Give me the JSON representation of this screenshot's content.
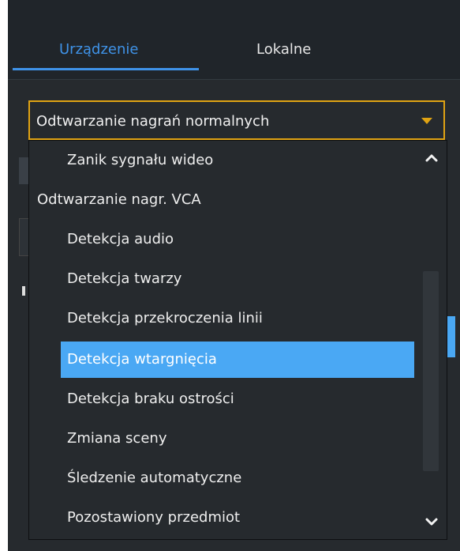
{
  "tabs": [
    {
      "label": "Urządzenie",
      "active": true
    },
    {
      "label": "Lokalne",
      "active": false
    }
  ],
  "dropdown": {
    "selected_value": "Odtwarzanie nagrań normalnych",
    "options": [
      {
        "label": "Zanik sygnału wideo",
        "type": "child"
      },
      {
        "label": "Odtwarzanie nagr. VCA",
        "type": "group"
      },
      {
        "label": "Detekcja audio",
        "type": "child"
      },
      {
        "label": "Detekcja twarzy",
        "type": "child"
      },
      {
        "label": "Detekcja przekroczenia linii",
        "type": "child"
      },
      {
        "label": "Detekcja wtargnięcia",
        "type": "child",
        "highlighted": true
      },
      {
        "label": "Detekcja braku ostrości",
        "type": "child"
      },
      {
        "label": "Zmiana sceny",
        "type": "child"
      },
      {
        "label": "Śledzenie automatyczne",
        "type": "child"
      },
      {
        "label": "Pozostawiony przedmiot",
        "type": "child"
      }
    ]
  },
  "colors": {
    "accent_blue": "#3f93e8",
    "highlight": "#4aa8f4",
    "select_border": "#e0a313",
    "panel_bg": "#262a2e"
  },
  "icons": {
    "caret": "caret-down-icon",
    "scroll_up": "chevron-up-icon",
    "scroll_down": "chevron-down-icon"
  }
}
